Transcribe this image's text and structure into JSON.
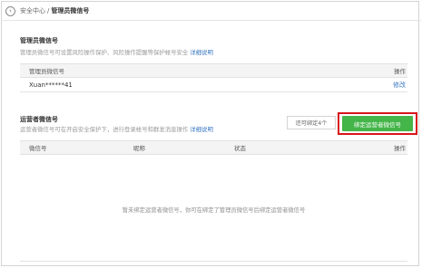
{
  "breadcrumb": {
    "back_symbol": "‹",
    "parent": "安全中心",
    "separator": "/",
    "current": "管理员微信号"
  },
  "admin_section": {
    "title": "管理员微信号",
    "description": "管理员微信号可设置风险操作保护、风险操作提醒等保护帐号安全",
    "detail_link": "详细说明",
    "table": {
      "headers": {
        "wechat_id": "管理员微信号",
        "action": "操作"
      },
      "rows": [
        {
          "wechat_id": "Xuan******41",
          "action": "修改"
        }
      ]
    }
  },
  "operator_section": {
    "title": "运营者微信号",
    "description": "运营者微信号可在开启安全保护下，进行登录帐号和群发消息操作",
    "detail_link": "详细说明",
    "remaining_count": "还可绑定4个",
    "bind_button": "绑定运营者微信号",
    "table": {
      "headers": {
        "wechat_id": "微信号",
        "nickname": "昵称",
        "status": "状态",
        "action": "操作"
      },
      "empty_message": "暂未绑定运营者微信号，你可在绑定了管理员微信号后绑定运营者微信号"
    }
  },
  "colors": {
    "accent_link": "#3b78c2",
    "primary_button": "#44b549",
    "highlight_border": "#d8141b"
  }
}
